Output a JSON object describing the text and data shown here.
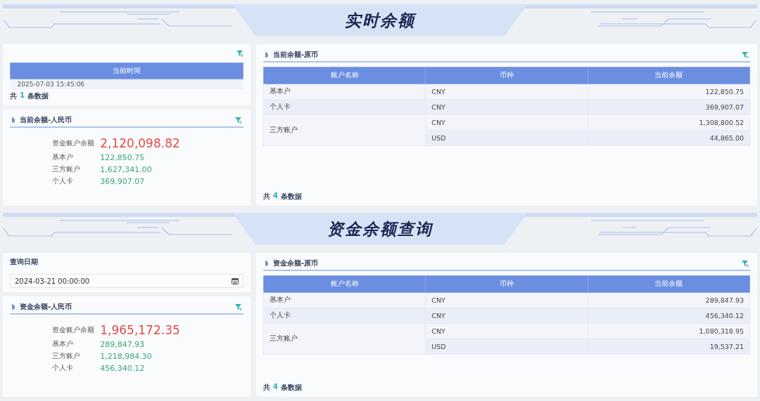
{
  "sections": [
    {
      "title": "实时余额",
      "left": [
        {
          "kind": "time_table",
          "column": "当前时间",
          "value": "2025-07-03 15:45:06",
          "footer": {
            "prefix": "共",
            "count": "1",
            "suffix": "条数据"
          }
        },
        {
          "kind": "summary",
          "title": "当前余额-人民币",
          "total_label": "资金账户余额",
          "total_value": "2,120,098.82",
          "items": [
            {
              "label": "基本户",
              "value": "122,850.75"
            },
            {
              "label": "三方账户",
              "value": "1,627,341.00"
            },
            {
              "label": "个人卡",
              "value": "369,907.07"
            }
          ]
        }
      ],
      "right": {
        "title": "当前余额-原币",
        "columns": [
          "账户名称",
          "币种",
          "当前余额"
        ],
        "rows": [
          {
            "account": "基本户",
            "entries": [
              {
                "currency": "CNY",
                "balance": "122,850.75"
              }
            ]
          },
          {
            "account": "个人卡",
            "entries": [
              {
                "currency": "CNY",
                "balance": "369,907.07"
              }
            ]
          },
          {
            "account": "三方账户",
            "entries": [
              {
                "currency": "CNY",
                "balance": "1,308,800.52"
              },
              {
                "currency": "USD",
                "balance": "44,865.00"
              }
            ]
          }
        ],
        "footer": {
          "prefix": "共",
          "count": "4",
          "suffix": "条数据"
        }
      }
    },
    {
      "title": "资金余额查询",
      "left": [
        {
          "kind": "date_filter",
          "label": "查询日期",
          "value": "2024-03-21 00:00:00"
        },
        {
          "kind": "summary",
          "title": "资金余额-人民币",
          "total_label": "资金账户余额",
          "total_value": "1,965,172.35",
          "items": [
            {
              "label": "基本户",
              "value": "289,847.93"
            },
            {
              "label": "三方账户",
              "value": "1,218,984.30"
            },
            {
              "label": "个人卡",
              "value": "456,340.12"
            }
          ]
        }
      ],
      "right": {
        "title": "资金余额-原币",
        "columns": [
          "账户名称",
          "币种",
          "当前余额"
        ],
        "rows": [
          {
            "account": "基本户",
            "entries": [
              {
                "currency": "CNY",
                "balance": "289,847.93"
              }
            ]
          },
          {
            "account": "个人卡",
            "entries": [
              {
                "currency": "CNY",
                "balance": "456,340.12"
              }
            ]
          },
          {
            "account": "三方账户",
            "entries": [
              {
                "currency": "CNY",
                "balance": "1,080,318.95"
              },
              {
                "currency": "USD",
                "balance": "19,537.21"
              }
            ]
          }
        ],
        "footer": {
          "prefix": "共",
          "count": "4",
          "suffix": "条数据"
        }
      }
    }
  ]
}
